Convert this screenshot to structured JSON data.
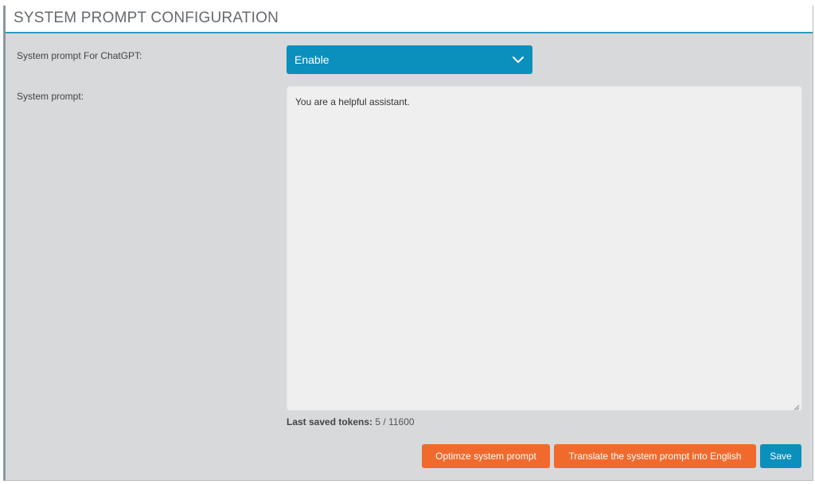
{
  "panel": {
    "title": "SYSTEM PROMPT CONFIGURATION"
  },
  "form": {
    "chatgpt_label": "System prompt For ChatGPT:",
    "chatgpt_select_value": "Enable",
    "prompt_label": "System prompt:",
    "prompt_value": "You are a helpful assistant.",
    "tokens_label": "Last saved tokens:",
    "tokens_value": "5 / 11600"
  },
  "actions": {
    "optimize_label": "Optimze system prompt",
    "translate_label": "Translate the system prompt into English",
    "save_label": "Save"
  },
  "colors": {
    "accent_blue": "#0b8fbd",
    "accent_orange": "#f06a2e",
    "panel_bg": "#d8d9db"
  },
  "icons": {
    "select_chevron": "chevron-down-icon",
    "resize": "resize-handle-icon"
  }
}
